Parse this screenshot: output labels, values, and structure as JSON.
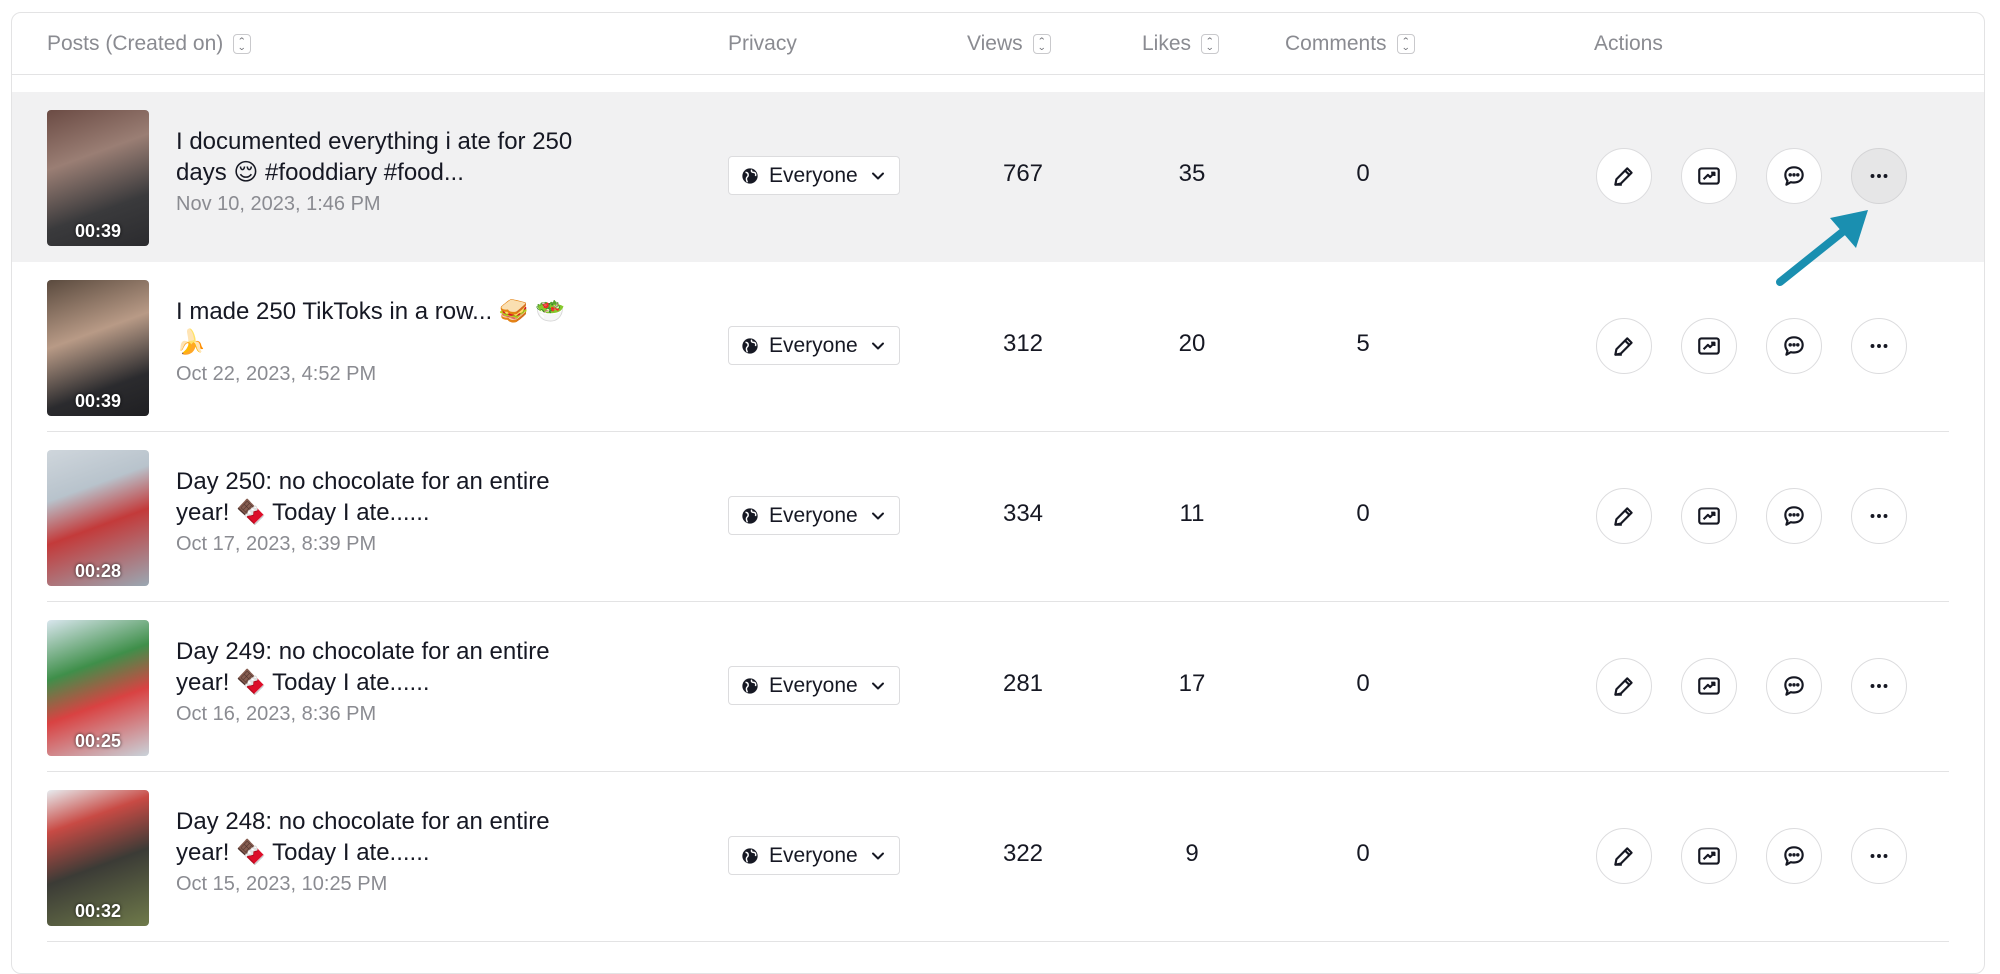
{
  "header": {
    "posts": "Posts (Created on)",
    "privacy": "Privacy",
    "views": "Views",
    "likes": "Likes",
    "comments": "Comments",
    "actions": "Actions"
  },
  "rows": [
    {
      "duration": "00:39",
      "title": "I documented everything i ate for 250 days 😌 #fooddiary #food...",
      "date": "Nov 10, 2023, 1:46 PM",
      "privacy": "Everyone",
      "views": "767",
      "likes": "35",
      "comments": "0"
    },
    {
      "duration": "00:39",
      "title": "I made 250 TikToks in a row... 🥪 🥗 🍌",
      "date": "Oct 22, 2023, 4:52 PM",
      "privacy": "Everyone",
      "views": "312",
      "likes": "20",
      "comments": "5"
    },
    {
      "duration": "00:28",
      "title": "Day 250: no chocolate for an entire year! 🍫 Today I ate......",
      "date": "Oct 17, 2023, 8:39 PM",
      "privacy": "Everyone",
      "views": "334",
      "likes": "11",
      "comments": "0"
    },
    {
      "duration": "00:25",
      "title": "Day 249: no chocolate for an entire year! 🍫 Today I ate......",
      "date": "Oct 16, 2023, 8:36 PM",
      "privacy": "Everyone",
      "views": "281",
      "likes": "17",
      "comments": "0"
    },
    {
      "duration": "00:32",
      "title": "Day 248: no chocolate for an entire year! 🍫 Today I ate......",
      "date": "Oct 15, 2023, 10:25 PM",
      "privacy": "Everyone",
      "views": "322",
      "likes": "9",
      "comments": "0"
    }
  ],
  "colors": {
    "arrow": "#1a8fb0",
    "highlight_row": "#f1f1f2"
  }
}
